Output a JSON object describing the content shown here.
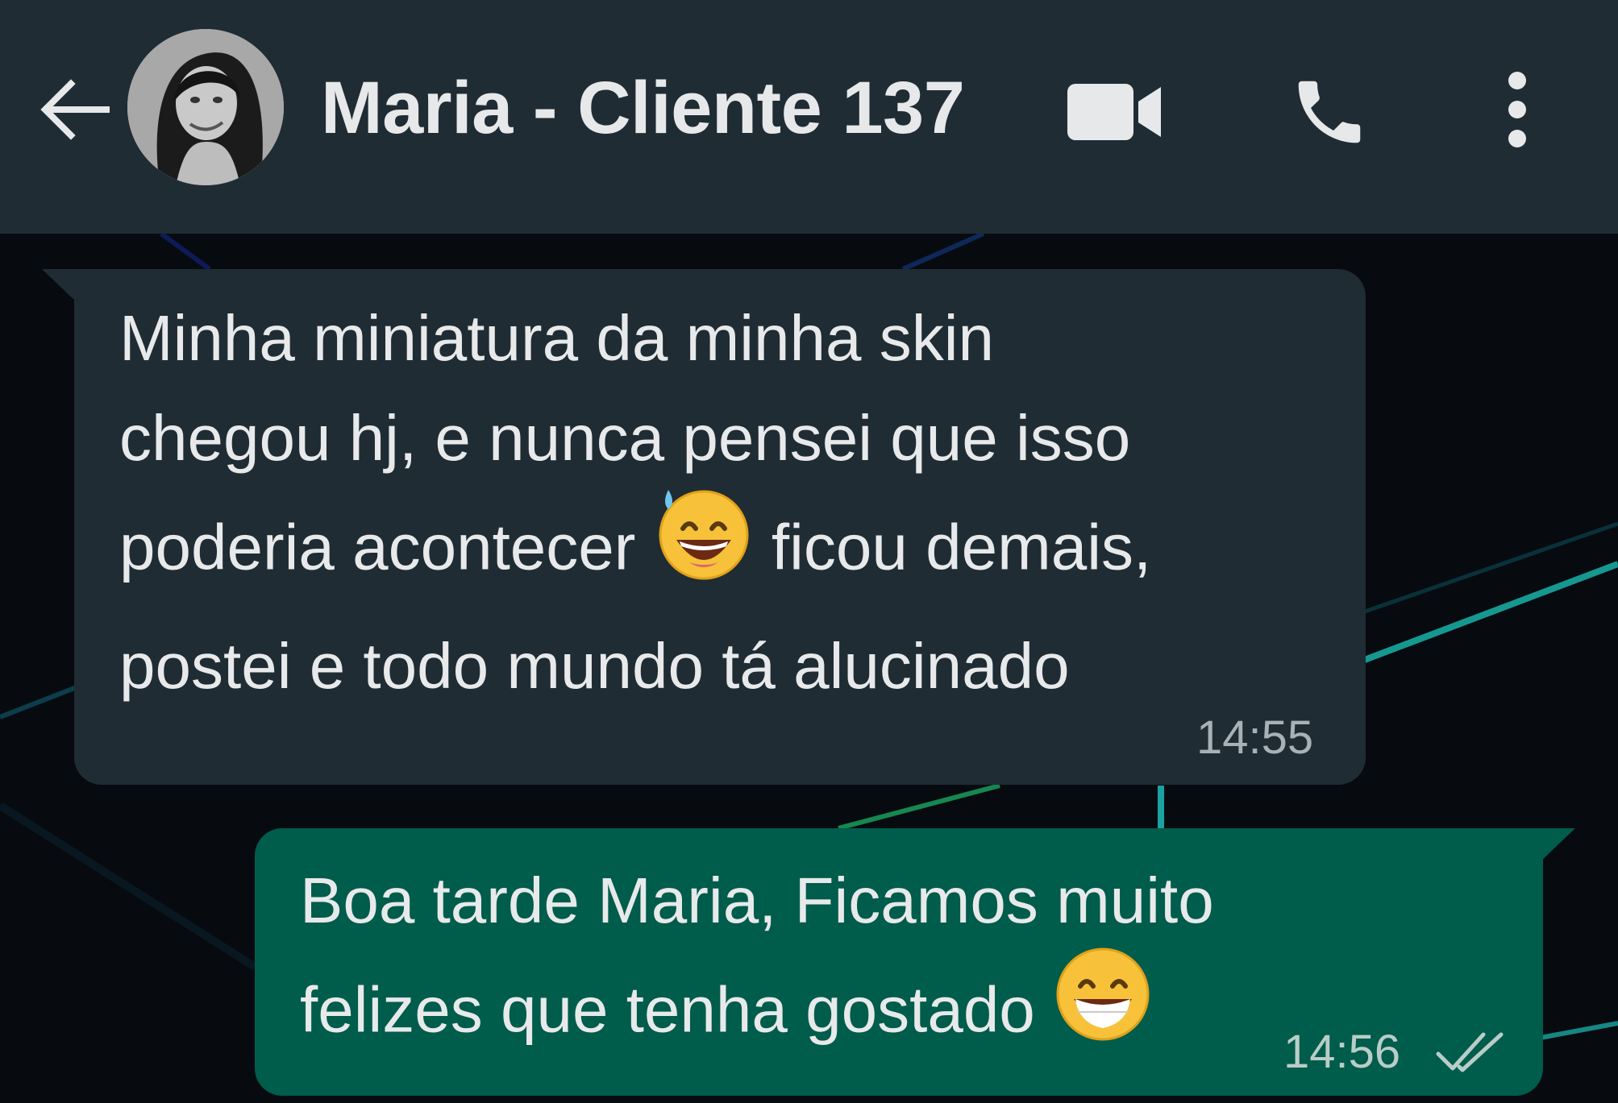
{
  "header": {
    "contact_name": "Maria - Cliente 137",
    "icons": [
      "back-arrow-icon",
      "avatar",
      "video-camera-icon",
      "phone-icon",
      "more-vert-icon"
    ]
  },
  "messages": [
    {
      "direction": "incoming",
      "lines": [
        "Minha miniatura da minha skin",
        "chegou hj, e nunca pensei que isso",
        "poderia acontecer",
        "ficou demais,",
        "postei e todo mundo tá alucinado"
      ],
      "emoji": "grinning-face-with-sweat-emoji",
      "time": "14:55"
    },
    {
      "direction": "outgoing",
      "lines": [
        "Boa tarde Maria, Ficamos muito",
        "felizes que tenha gostado"
      ],
      "emoji": "beaming-face-with-smiling-eyes-emoji",
      "time": "14:56",
      "status": "read-double-check-icon"
    }
  ],
  "colors": {
    "header_bg": "#202c33",
    "incoming_bubble": "#202c33",
    "outgoing_bubble": "#005c4b",
    "text": "#e7e9ea",
    "chat_bg": "#070b10"
  }
}
